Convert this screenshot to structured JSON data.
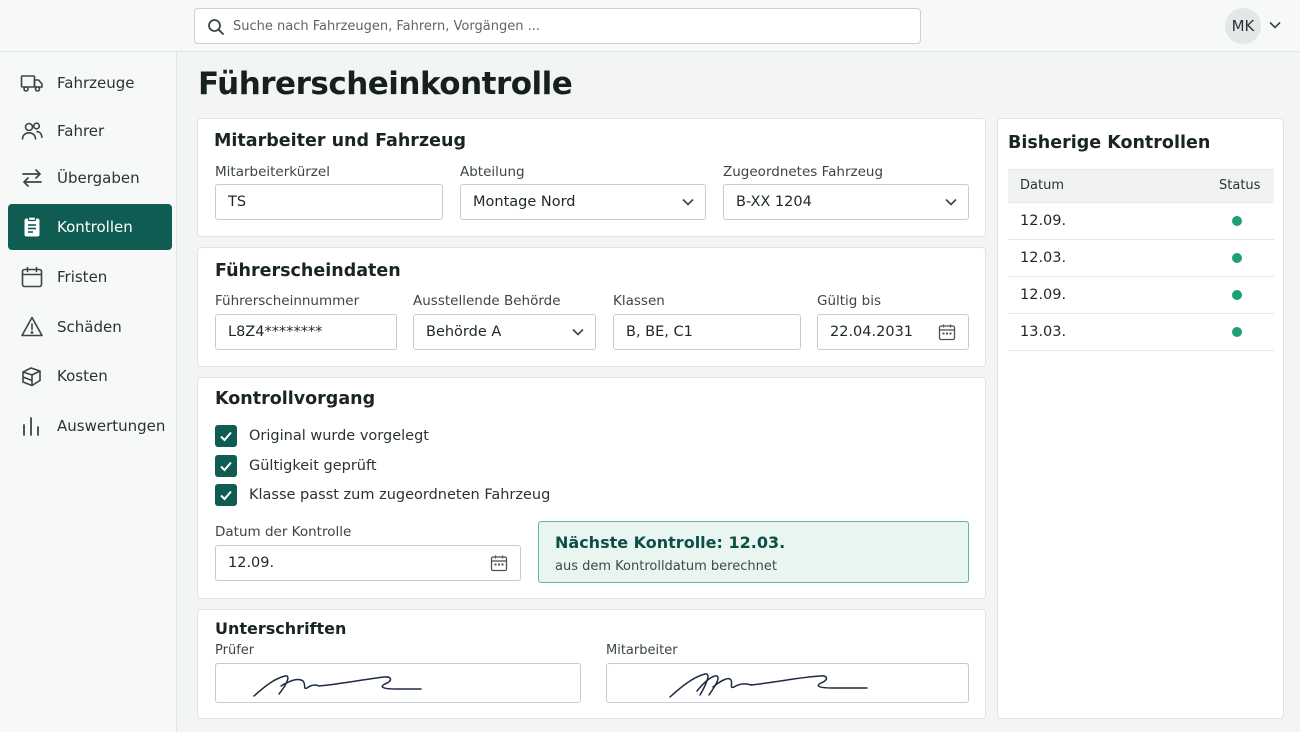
{
  "search": {
    "placeholder": "Suche nach Fahrzeugen, Fahrern, Vorgängen ..."
  },
  "user": {
    "initials": "MK"
  },
  "sidebar": {
    "items": [
      {
        "label": "Fahrzeuge",
        "icon": "truck-icon"
      },
      {
        "label": "Fahrer",
        "icon": "users-icon"
      },
      {
        "label": "Übergaben",
        "icon": "swap-arrows-icon"
      },
      {
        "label": "Kontrollen",
        "icon": "clipboard-icon",
        "active": true
      },
      {
        "label": "Fristen",
        "icon": "calendar-icon"
      },
      {
        "label": "Schäden",
        "icon": "warning-icon"
      },
      {
        "label": "Kosten",
        "icon": "coins-icon"
      },
      {
        "label": "Auswertungen",
        "icon": "bar-chart-icon"
      }
    ]
  },
  "page": {
    "title": "Führerscheinkontrolle"
  },
  "employee_vehicle": {
    "title": "Mitarbeiter und Fahrzeug",
    "employee_code": {
      "label": "Mitarbeiterkürzel",
      "value": "TS"
    },
    "department": {
      "label": "Abteilung",
      "value": "Montage Nord"
    },
    "vehicle": {
      "label": "Zugeordnetes Fahrzeug",
      "value": "B-XX 1204"
    }
  },
  "license": {
    "title": "Führerscheindaten",
    "number": {
      "label": "Führerscheinnummer",
      "value": "L8Z4********"
    },
    "authority": {
      "label": "Ausstellende Behörde",
      "value": "Behörde A"
    },
    "classes": {
      "label": "Klassen",
      "value": "B, BE, C1"
    },
    "valid_until": {
      "label": "Gültig bis",
      "value": "22.04.2031"
    }
  },
  "check": {
    "title": "Kontrollvorgang",
    "items": [
      {
        "label": "Original wurde vorgelegt",
        "checked": true
      },
      {
        "label": "Gültigkeit geprüft",
        "checked": true
      },
      {
        "label": "Klasse passt zum zugeordneten Fahrzeug",
        "checked": true
      }
    ],
    "date": {
      "label": "Datum der Kontrolle",
      "value": "12.09."
    },
    "next": {
      "title": "Nächste Kontrolle: 12.03.",
      "subtitle": "aus dem Kontrolldatum berechnet"
    }
  },
  "signatures": {
    "title": "Unterschriften",
    "inspector_label": "Prüfer",
    "employee_label": "Mitarbeiter"
  },
  "history": {
    "title": "Bisherige Kontrollen",
    "columns": [
      "Datum",
      "Status"
    ],
    "rows": [
      {
        "date": "12.09.",
        "status_color": "#1f9e7a"
      },
      {
        "date": "12.03.",
        "status_color": "#1f9e7a"
      },
      {
        "date": "12.09.",
        "status_color": "#1f9e7a"
      },
      {
        "date": "13.03.",
        "status_color": "#1f9e7a"
      }
    ]
  },
  "colors": {
    "accent": "#0e5c52",
    "success": "#1f9e7a",
    "info_bg": "#e8f5f1"
  }
}
